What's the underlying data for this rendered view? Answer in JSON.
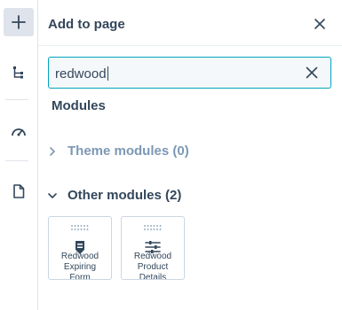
{
  "panel": {
    "title": "Add to page"
  },
  "search": {
    "value": "redwood"
  },
  "modules_heading": "Modules",
  "groups": [
    {
      "label": "Theme modules (0)",
      "state": "collapsed"
    },
    {
      "label": "Other modules (2)",
      "state": "expanded"
    }
  ],
  "modules": [
    {
      "label_line1": "Redwood",
      "label_line2": "Expiring",
      "label_line3": "Form",
      "icon": "form-icon"
    },
    {
      "label_line1": "Redwood",
      "label_line2": "Product",
      "label_line3": "Details",
      "icon": "sliders-icon"
    }
  ],
  "rail": [
    {
      "icon": "plus-icon",
      "active": true
    },
    {
      "icon": "tree-icon",
      "active": false
    },
    {
      "icon": "gauge-icon",
      "active": false
    },
    {
      "icon": "document-icon",
      "active": false
    }
  ],
  "colors": {
    "accent": "#00a4bd",
    "text": "#33475b",
    "muted": "#7c98b6",
    "border": "#cbd6e2"
  }
}
